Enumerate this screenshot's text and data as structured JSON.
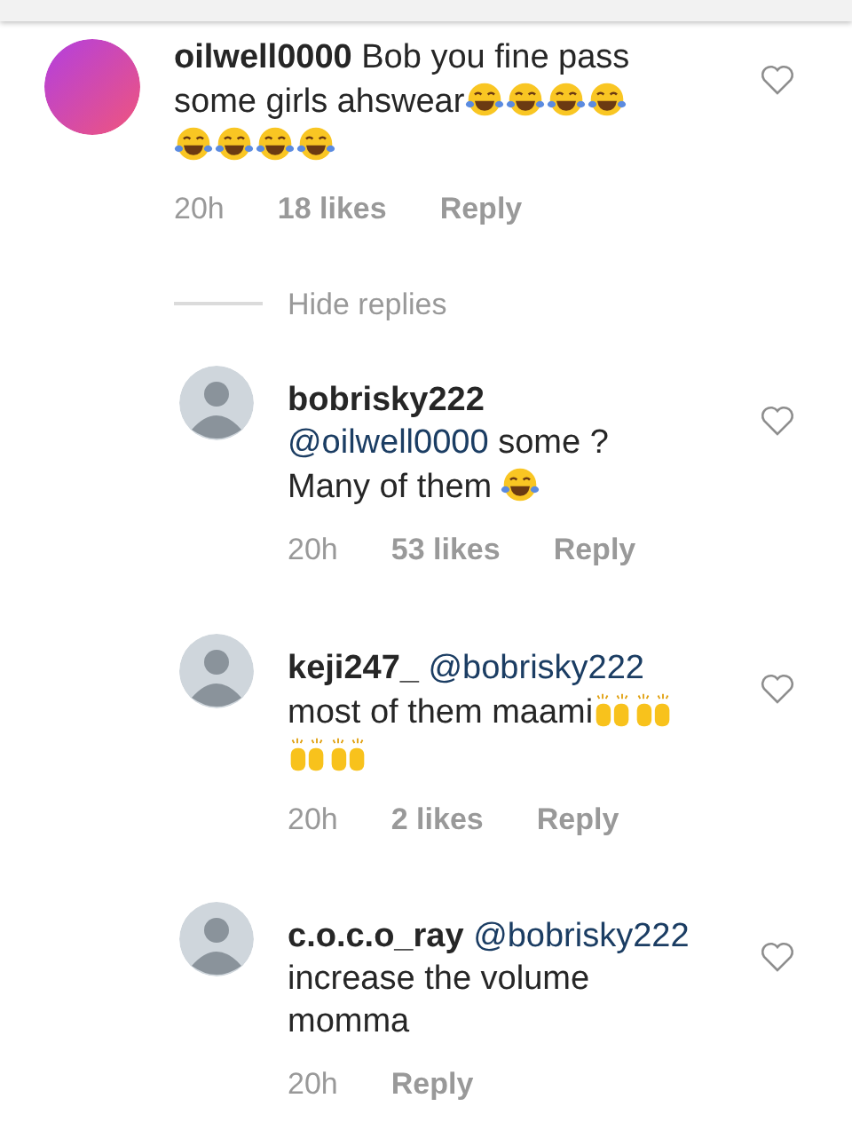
{
  "comment": {
    "lines": [
      [
        {
          "kind": "username",
          "text": "oilwell0000"
        },
        {
          "kind": "text",
          "text": "Bob you fine pass"
        }
      ],
      [
        {
          "kind": "text",
          "text": "some girls ahswear"
        },
        {
          "kind": "laugh"
        },
        {
          "kind": "laugh"
        },
        {
          "kind": "laugh"
        },
        {
          "kind": "laugh"
        }
      ],
      [
        {
          "kind": "laugh"
        },
        {
          "kind": "laugh"
        },
        {
          "kind": "laugh"
        },
        {
          "kind": "laugh"
        }
      ]
    ],
    "time": "20h",
    "likes": "18 likes",
    "reply": "Reply"
  },
  "hide_replies": "Hide replies",
  "replies": [
    {
      "lines": [
        [
          {
            "kind": "username",
            "text": "bobrisky222"
          }
        ],
        [
          {
            "kind": "mention",
            "text": "@oilwell0000"
          },
          {
            "kind": "text",
            "text": " some ?"
          }
        ],
        [
          {
            "kind": "text",
            "text": "Many of them "
          },
          {
            "kind": "laugh"
          }
        ]
      ],
      "time": "20h",
      "likes": "53 likes",
      "reply": "Reply"
    },
    {
      "lines": [
        [
          {
            "kind": "username",
            "text": "keji247_"
          },
          {
            "kind": "mention",
            "text": "@bobrisky222"
          }
        ],
        [
          {
            "kind": "text",
            "text": "most of them maami"
          },
          {
            "kind": "raised-hands"
          },
          {
            "kind": "raised-hands"
          }
        ],
        [
          {
            "kind": "raised-hands"
          },
          {
            "kind": "raised-hands"
          }
        ]
      ],
      "time": "20h",
      "likes": "2 likes",
      "reply": "Reply"
    },
    {
      "lines": [
        [
          {
            "kind": "username",
            "text": "c.o.c.o_ray"
          },
          {
            "kind": "mention",
            "text": "@bobrisky222"
          }
        ],
        [
          {
            "kind": "text",
            "text": "increase the volume"
          }
        ],
        [
          {
            "kind": "text",
            "text": "momma"
          }
        ]
      ],
      "time": "20h",
      "reply": "Reply"
    }
  ]
}
